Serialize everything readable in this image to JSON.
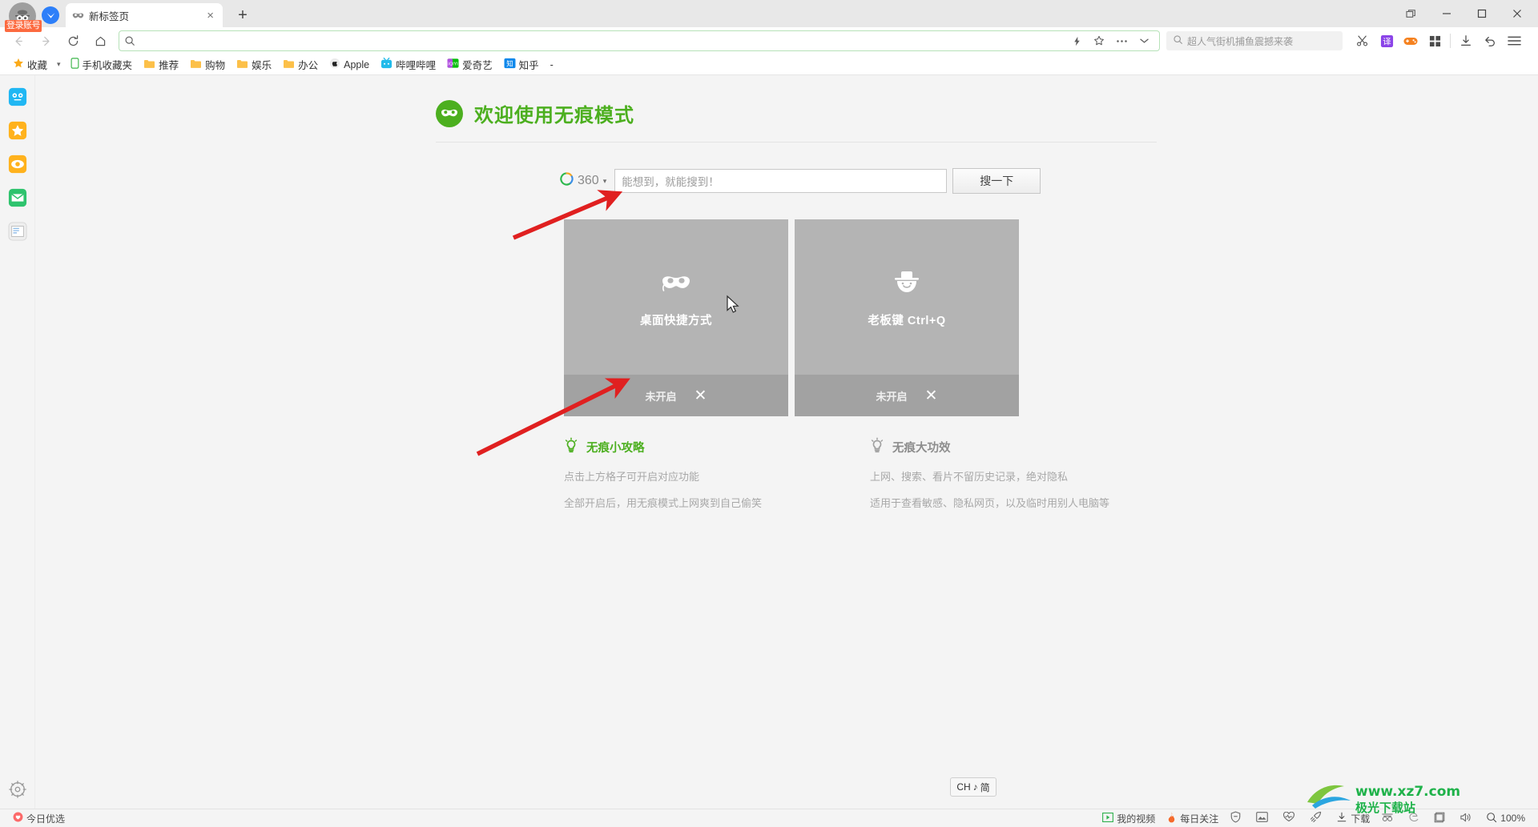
{
  "window": {
    "titlebar": {
      "login_badge": "登录账号",
      "avatar_icon": "incognito-avatar-icon",
      "message_icon": "message-icon",
      "tab": {
        "favicon": "incognito-mask-icon",
        "title": "新标签页",
        "close": "×"
      },
      "new_tab": "+",
      "controls": {
        "restore": "restore-icon",
        "minimize": "−",
        "maximize": "□",
        "close": "✕"
      }
    },
    "navbar": {
      "back": "back-arrow-icon",
      "forward": "forward-arrow-icon",
      "reload": "reload-icon",
      "home": "home-icon",
      "omnibox": {
        "search_icon": "search-icon",
        "value": "",
        "placeholder": ""
      },
      "omnibox_actions": [
        "lightning-icon",
        "star-icon",
        "more-dots-icon",
        "chevron-down-icon"
      ],
      "toolbar_search": {
        "icon": "search-icon",
        "placeholder": "超人气街机捕鱼震撼来袭"
      },
      "tools": [
        "scissors-icon",
        "translate-icon",
        "game-icon",
        "apps-grid-icon",
        "download-icon",
        "undo-icon",
        "menu-icon"
      ]
    },
    "bookmarks": {
      "caret": "▾",
      "items": [
        {
          "label": "收藏",
          "icon": "star-icon"
        },
        {
          "label": "手机收藏夹",
          "icon": "phone-icon"
        },
        {
          "label": "推荐",
          "icon": "folder-icon"
        },
        {
          "label": "购物",
          "icon": "folder-icon"
        },
        {
          "label": "娱乐",
          "icon": "folder-icon"
        },
        {
          "label": "办公",
          "icon": "folder-icon"
        },
        {
          "label": "Apple",
          "icon": "apple-icon"
        },
        {
          "label": "哔哩哔哩",
          "icon": "bilibili-icon"
        },
        {
          "label": "爱奇艺",
          "icon": "iqiyi-icon"
        },
        {
          "label": "知乎",
          "icon": "zhihu-icon"
        }
      ],
      "overflow": "-"
    }
  },
  "sidebar": {
    "items": [
      {
        "icon": "panda-icon",
        "label": ""
      },
      {
        "icon": "star-favorites-icon",
        "label": ""
      },
      {
        "icon": "eye-view-icon",
        "label": ""
      },
      {
        "icon": "mail-icon",
        "label": ""
      },
      {
        "icon": "news-icon",
        "label": ""
      }
    ],
    "bottom": {
      "icon": "gear-icon",
      "label": ""
    }
  },
  "page": {
    "welcome": {
      "icon": "incognito-mask-icon",
      "title": "欢迎使用无痕模式"
    },
    "search": {
      "engine": {
        "logo": "360-logo-icon",
        "name": "360",
        "caret": "▾"
      },
      "placeholder": "能想到，就能搜到！",
      "value": "",
      "button": "搜一下"
    },
    "cards": [
      {
        "icon": "incognito-mask-icon",
        "title": "桌面快捷方式",
        "status": "未开启",
        "close": "✕"
      },
      {
        "icon": "boss-hat-icon",
        "title": "老板键 Ctrl+Q",
        "status": "未开启",
        "close": "✕"
      }
    ],
    "tips": [
      {
        "icon": "lightbulb-icon",
        "title": "无痕小攻略",
        "color": "#4caf1f",
        "lines": [
          "点击上方格子可开启对应功能",
          "全部开启后，用无痕模式上网爽到自己偷笑"
        ]
      },
      {
        "icon": "lightbulb-icon",
        "title": "无痕大功效",
        "color": "#8d8d8d",
        "lines": [
          "上网、搜索、看片不留历史记录，绝对隐私",
          "适用于查看敏感、隐私网页，以及临时用别人电脑等"
        ]
      }
    ],
    "ime": {
      "lang": "CH",
      "note": "♪",
      "mode": "简"
    }
  },
  "statusbar": {
    "left": {
      "icon": "heart-icon",
      "label": "今日优选"
    },
    "right": [
      {
        "icon": "video-icon",
        "label": "我的视频"
      },
      {
        "icon": "flame-icon",
        "label": "每日关注"
      },
      {
        "icon": "shield-icon",
        "label": ""
      },
      {
        "icon": "image-icon",
        "label": ""
      },
      {
        "icon": "heartbeat-icon",
        "label": ""
      },
      {
        "icon": "rocket-icon",
        "label": ""
      },
      {
        "icon": "download-icon",
        "label": "下载"
      },
      {
        "icon": "incognito-small-icon",
        "label": ""
      },
      {
        "icon": "edge-icon",
        "label": ""
      },
      {
        "icon": "window-icon",
        "label": ""
      },
      {
        "icon": "volume-icon",
        "label": ""
      },
      {
        "icon": "zoom-icon",
        "label": "100%"
      }
    ]
  },
  "watermark": {
    "text": "www.xz7.com",
    "brand": "极光下载站"
  },
  "colors": {
    "accent_green": "#4caf1f",
    "badge_orange": "#fc6a3f",
    "card_gray": "#b4b4b4",
    "card_foot_gray": "#a2a2a2",
    "arrow_red": "#e02020"
  }
}
